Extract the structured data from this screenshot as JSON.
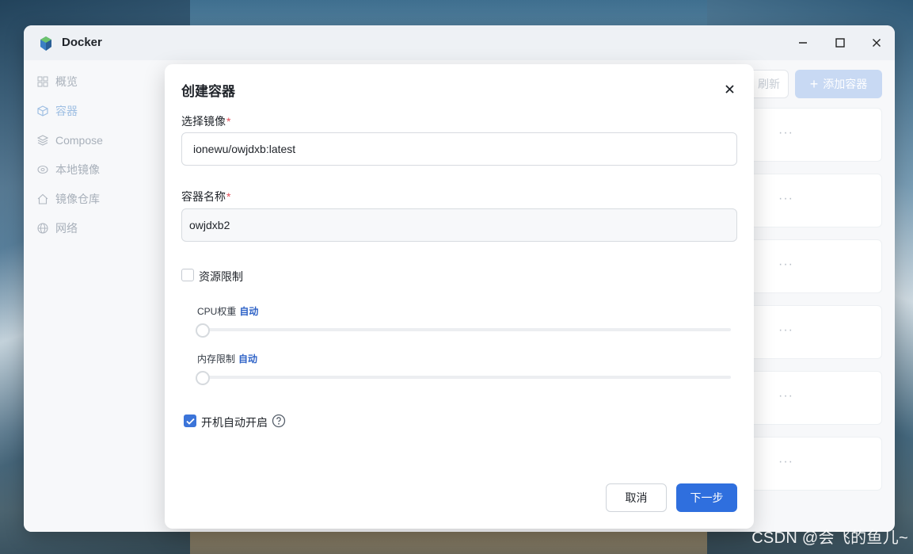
{
  "window": {
    "title": "Docker",
    "minimize_glyph": "—",
    "maximize_glyph": "☐",
    "close_glyph": "✕"
  },
  "sidebar": {
    "items": [
      {
        "label": "概览",
        "icon": "grid-icon"
      },
      {
        "label": "容器",
        "icon": "cube-icon",
        "active": true
      },
      {
        "label": "Compose",
        "icon": "layers-icon"
      },
      {
        "label": "本地镜像",
        "icon": "disk-icon"
      },
      {
        "label": "镜像仓库",
        "icon": "home-icon"
      },
      {
        "label": "网络",
        "icon": "globe-icon"
      }
    ]
  },
  "toolbar": {
    "refresh_label": "刷新",
    "add_label": "添加容器",
    "add_glyph": "+"
  },
  "container_rows": {
    "more_glyph": "···"
  },
  "dialog": {
    "title": "创建容器",
    "image_label": "选择镜像",
    "image_value": "ionewu/owjdxb:latest",
    "name_label": "容器名称",
    "name_value": "owjdxb2",
    "required_mark": "*",
    "resource_limit_label": "资源限制",
    "resource_limit_checked": false,
    "cpu_label": "CPU权重",
    "cpu_value": "自动",
    "memory_label": "内存限制",
    "memory_value": "自动",
    "autostart_label": "开机自动开启",
    "autostart_checked": true,
    "cancel_label": "取消",
    "next_label": "下一步"
  },
  "watermark": "CSDN @会飞的鱼儿~",
  "colors": {
    "accent": "#2f6fde",
    "power_green": "#8fd6a0",
    "required": "#e34d59"
  }
}
